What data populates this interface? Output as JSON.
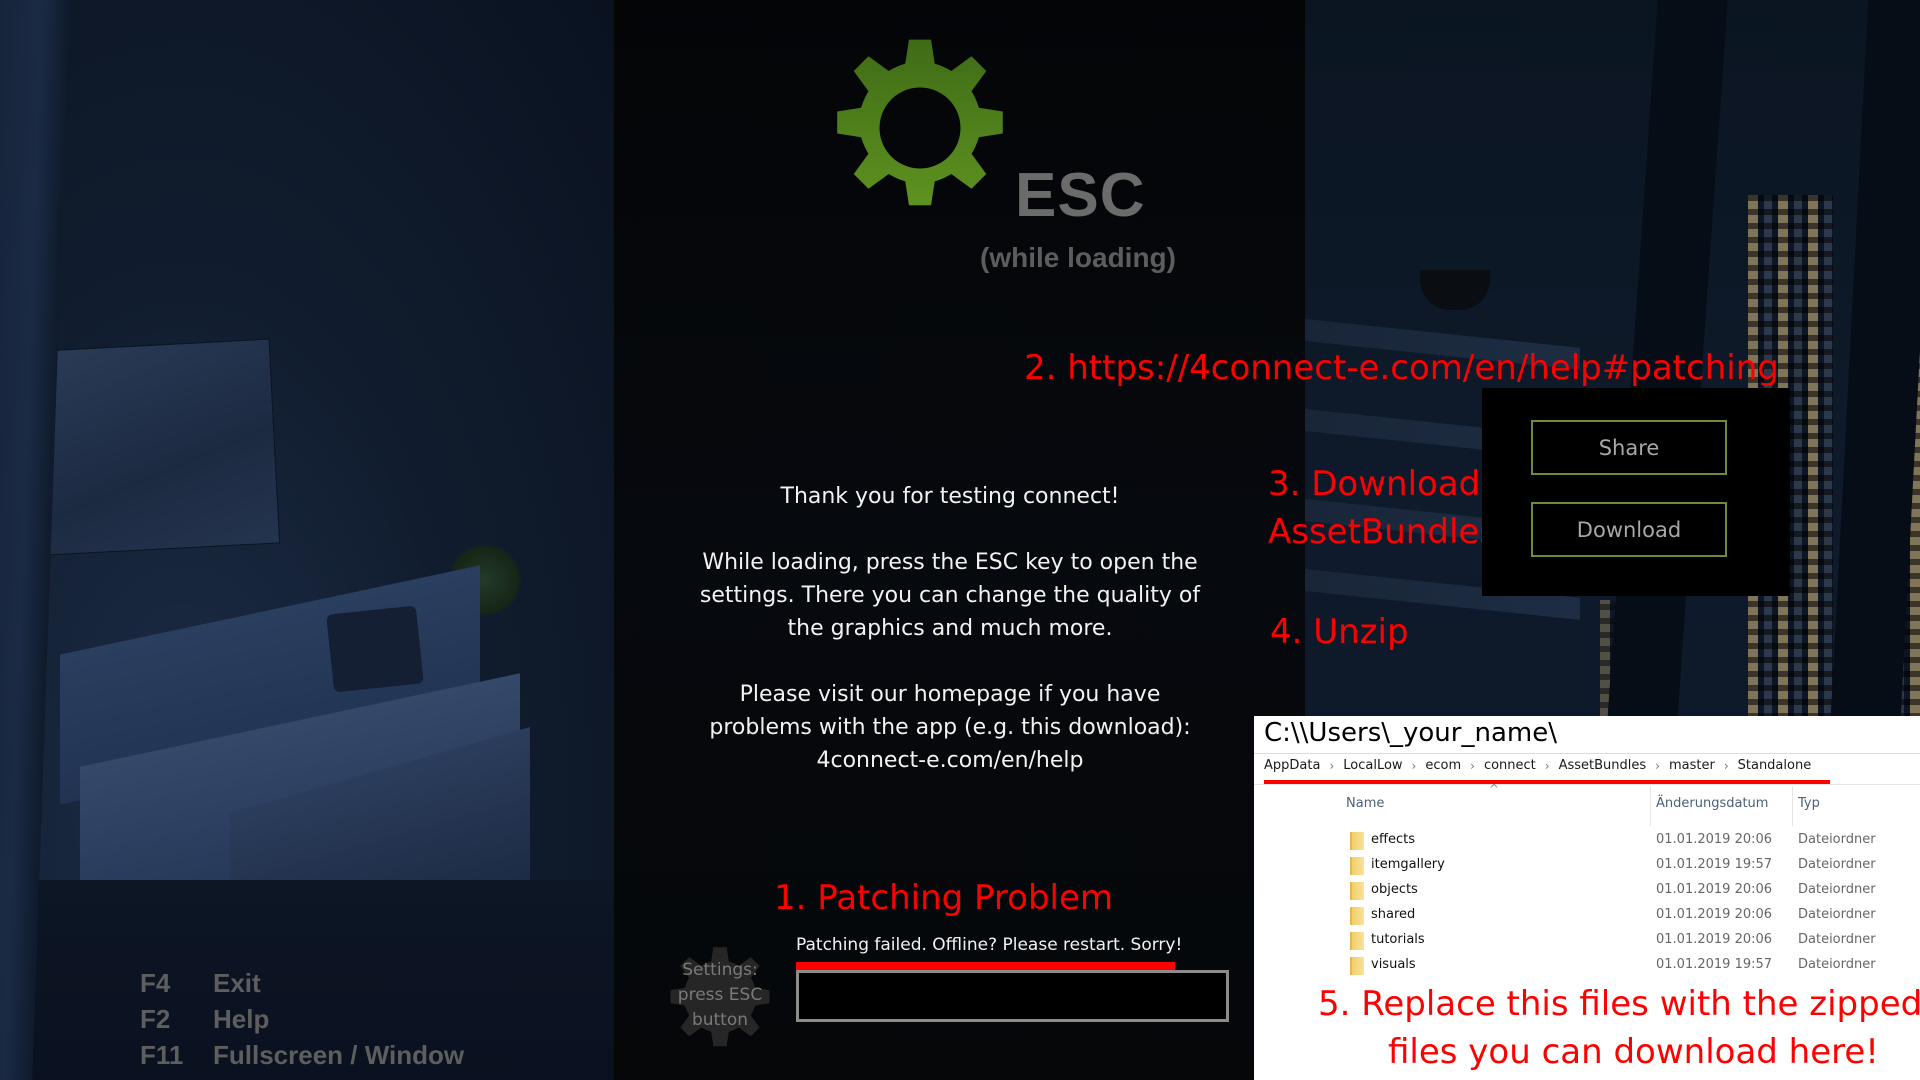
{
  "header": {
    "esc_title": "ESC",
    "esc_subtitle": "(while loading)"
  },
  "info": {
    "paragraph_1": "Thank you for testing connect!",
    "paragraph_2": "While loading, press the ESC key to open the settings. There you can change the quality of the graphics and much more.",
    "paragraph_3_line_1": "Please visit our homepage if you have problems with the app (e.g. this download):",
    "paragraph_3_link": "4connect-e.com/en/help"
  },
  "annotations": {
    "step_1": "1. Patching Problem",
    "step_2": "2. https://4connect-e.com/en/help#patching",
    "step_3_line_1": "3. Download",
    "step_3_line_2": "AssetBundles",
    "step_4": "4. Unzip",
    "step_5_line_1": "5. Replace this files with the zipped",
    "step_5_line_2": "files you can download here!",
    "color": "#ff0000"
  },
  "panel": {
    "share_label": "Share",
    "download_label": "Download",
    "button_border_color": "#6f8a3a"
  },
  "settings_hint": {
    "line_1": "Settings:",
    "line_2": "press ESC",
    "line_3": "button"
  },
  "loading": {
    "status": "Patching failed. Offline? Please restart. Sorry!",
    "progress_percent": 0
  },
  "keys": [
    {
      "key": "F4",
      "action": "Exit"
    },
    {
      "key": "F2",
      "action": "Help"
    },
    {
      "key": "F11",
      "action": "Fullscreen / Window"
    }
  ],
  "explorer": {
    "path_prefix": "C:\\\\Users\\_your_name\\",
    "breadcrumb": [
      "AppData",
      "LocalLow",
      "ecom",
      "connect",
      "AssetBundles",
      "master",
      "Standalone"
    ],
    "columns": {
      "name": "Name",
      "date": "Änderungsdatum",
      "type": "Typ"
    },
    "files": [
      {
        "name": "effects",
        "date": "01.01.2019 20:06",
        "type": "Dateiordner"
      },
      {
        "name": "itemgallery",
        "date": "01.01.2019 19:57",
        "type": "Dateiordner"
      },
      {
        "name": "objects",
        "date": "01.01.2019 20:06",
        "type": "Dateiordner"
      },
      {
        "name": "shared",
        "date": "01.01.2019 20:06",
        "type": "Dateiordner"
      },
      {
        "name": "tutorials",
        "date": "01.01.2019 20:06",
        "type": "Dateiordner"
      },
      {
        "name": "visuals",
        "date": "01.01.2019 19:57",
        "type": "Dateiordner"
      }
    ]
  },
  "colors": {
    "gear_green": "#5a8a1e",
    "text_grey": "#6b6b6b"
  }
}
